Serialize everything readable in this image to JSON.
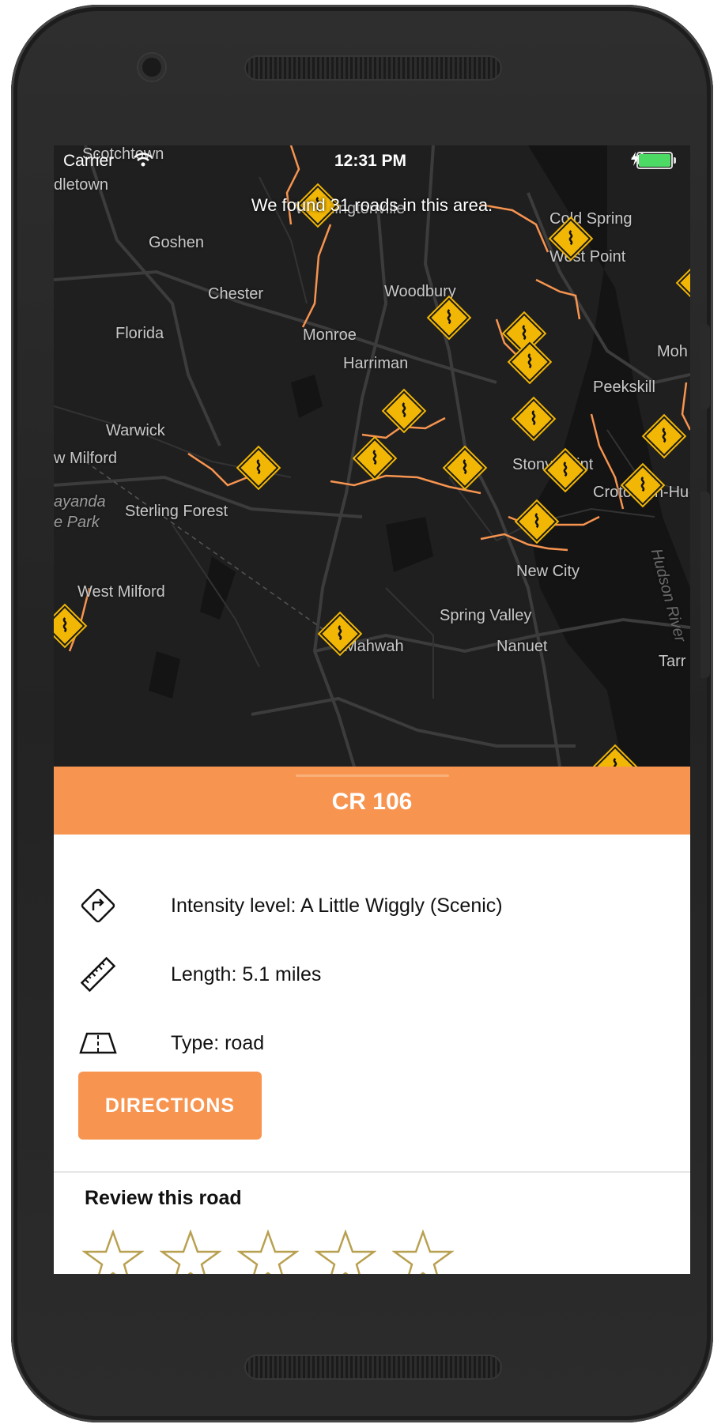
{
  "status_bar": {
    "carrier": "Carrier",
    "time": "12:31 PM",
    "battery_level": 1.0
  },
  "map": {
    "banner": "We found 31 roads in this area.",
    "places": [
      "Scotchtown",
      "dletown",
      "Washingtonville",
      "Cold Spring",
      "West Point",
      "Goshen",
      "Chester",
      "Woodbury",
      "Florida",
      "Monroe",
      "Moh",
      "Harriman",
      "Peekskill",
      "Warwick",
      "w Milford",
      "Stony Point",
      "Croton-on-Hu",
      "ayanda",
      "e Park",
      "Sterling Forest",
      "New City",
      "West Milford",
      "Spring Valley",
      "Hudson River",
      "Mahwah",
      "Nanuet",
      "Tarr"
    ],
    "road_color": "#f79450",
    "marker_icon": "winding-road-sign-icon",
    "marker_color": "#f2b705"
  },
  "road": {
    "name": "CR 106",
    "intensity_label": "Intensity level: A Little Wiggly (Scenic)",
    "intensity_icon": "turn-right-sign-icon",
    "length_label": "Length: 5.1 miles",
    "length_icon": "ruler-icon",
    "type_label": "Type: road",
    "type_icon": "road-icon",
    "directions_button": "DIRECTIONS"
  },
  "review": {
    "title": "Review this road",
    "rating": 0,
    "max_rating": 5,
    "star_color": "#b8a050"
  },
  "accent_color": "#f79450"
}
